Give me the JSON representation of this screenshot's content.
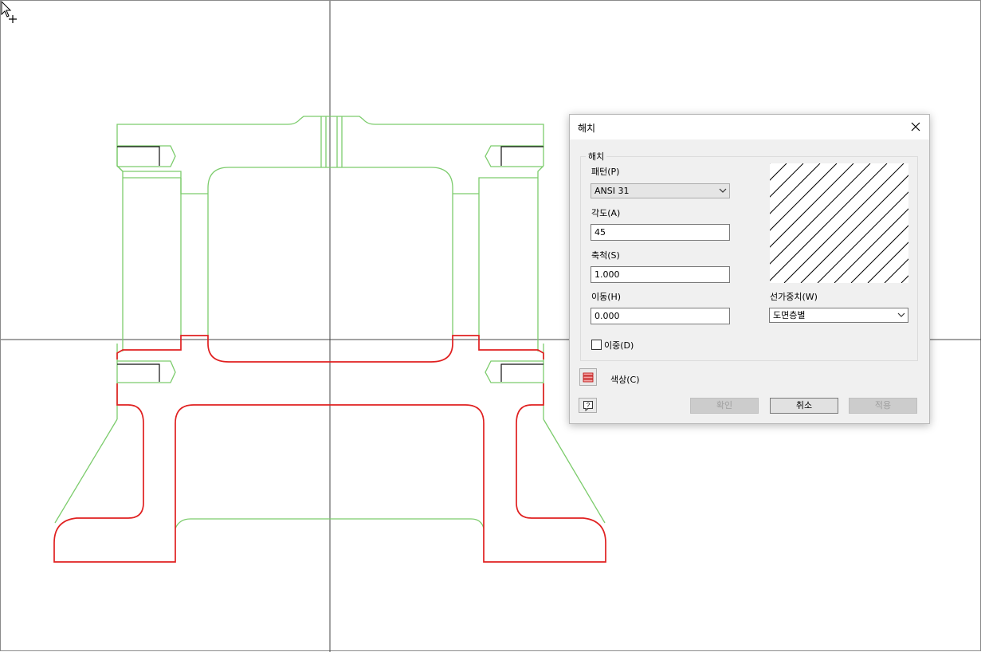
{
  "dialog": {
    "title": "해치",
    "group_label": "해치",
    "pattern": {
      "label": "패턴(P)",
      "value": "ANSI 31"
    },
    "angle": {
      "label": "각도(A)",
      "value": "45"
    },
    "scale": {
      "label": "축척(S)",
      "value": "1.000"
    },
    "shift": {
      "label": "이동(H)",
      "value": "0.000"
    },
    "lineweight": {
      "label": "선가중치(W)",
      "value": "도면층별"
    },
    "double": {
      "label": "이중(D)",
      "checked": false
    },
    "color": {
      "label": "색상(C)"
    },
    "buttons": {
      "ok": "확인",
      "cancel": "취소",
      "apply": "적용"
    }
  },
  "colors": {
    "sketch_green": "#7ccc6c",
    "profile_red": "#e02020",
    "axis": "#333333",
    "dialog_bg": "#f0f0f0"
  }
}
